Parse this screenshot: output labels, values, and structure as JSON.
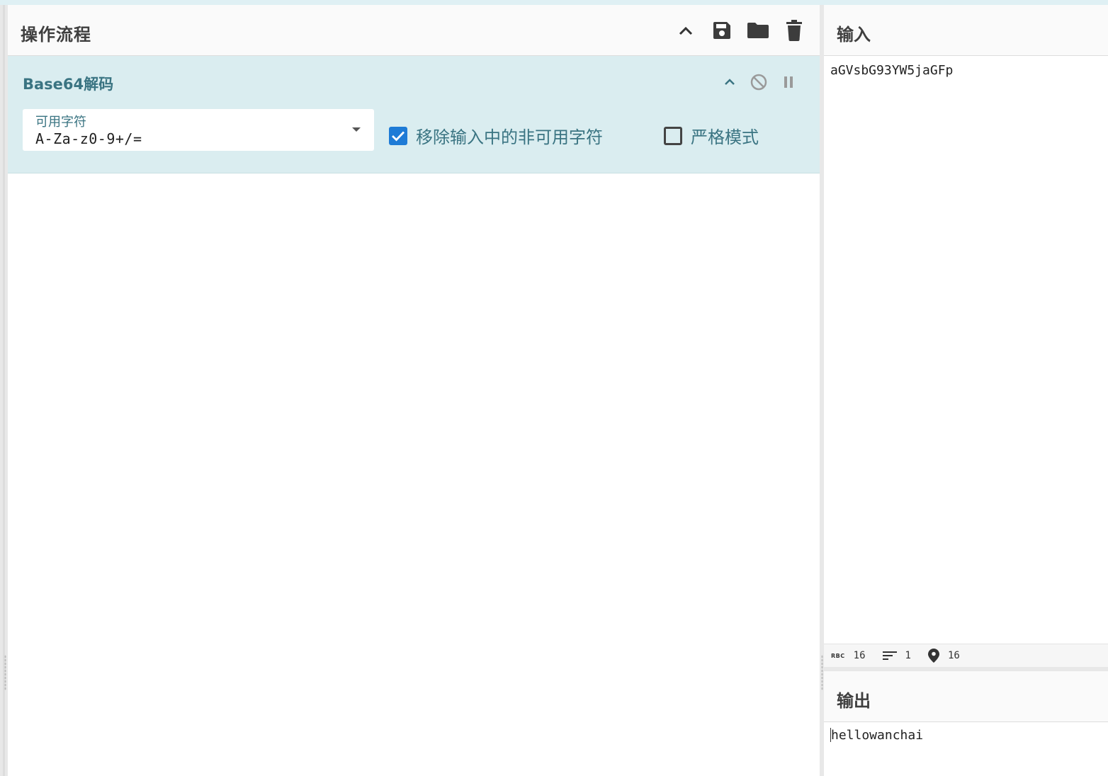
{
  "recipe": {
    "title": "操作流程",
    "operation": {
      "name": "Base64解码",
      "alphabet_label": "可用字符",
      "alphabet_value": "A-Za-z0-9+/=",
      "remove_non_alphabet": {
        "label": "移除输入中的非可用字符",
        "checked": true
      },
      "strict_mode": {
        "label": "严格模式",
        "checked": false
      }
    }
  },
  "input": {
    "title": "输入",
    "text": "aGVsbG93YW5jaGFp",
    "status": {
      "abc_glyph": "RBC",
      "length": "16",
      "lines": "1",
      "position": "16"
    }
  },
  "output": {
    "title": "输出",
    "text": "hellowanchai"
  },
  "colors": {
    "accent": "#1e7bd6",
    "operation_bg": "#daedf0",
    "operation_text": "#3a7482"
  },
  "icons": [
    "chevron-up-icon",
    "save-icon",
    "folder-icon",
    "trash-icon",
    "disable-icon",
    "pause-icon",
    "dropdown-caret-icon",
    "checkmark-icon",
    "lines-icon",
    "location-pin-icon"
  ]
}
